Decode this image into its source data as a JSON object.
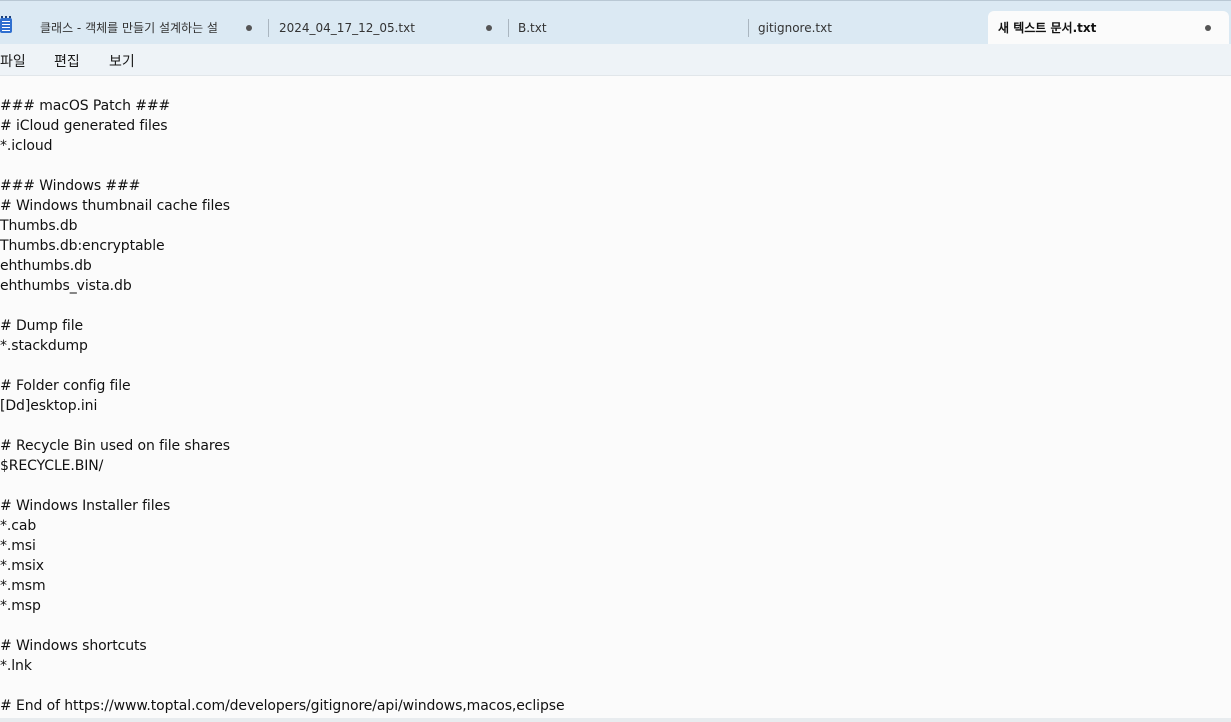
{
  "tabs": [
    {
      "label": "클래스 - 객체를 만들기 설계하는 설",
      "modified": true,
      "active": false
    },
    {
      "label": "2024_04_17_12_05.txt",
      "modified": true,
      "active": false
    },
    {
      "label": "B.txt",
      "modified": false,
      "active": false
    },
    {
      "label": "gitignore.txt",
      "modified": false,
      "active": false
    },
    {
      "label": "새 텍스트 문서.txt",
      "modified": true,
      "active": true
    }
  ],
  "menu": {
    "file": "파일",
    "edit": "편집",
    "view": "보기"
  },
  "editor_lines": [
    "### macOS Patch ###",
    "# iCloud generated files",
    "*.icloud",
    "",
    "### Windows ###",
    "# Windows thumbnail cache files",
    "Thumbs.db",
    "Thumbs.db:encryptable",
    "ehthumbs.db",
    "ehthumbs_vista.db",
    "",
    "# Dump file",
    "*.stackdump",
    "",
    "# Folder config file",
    "[Dd]esktop.ini",
    "",
    "# Recycle Bin used on file shares",
    "$RECYCLE.BIN/",
    "",
    "# Windows Installer files",
    "*.cab",
    "*.msi",
    "*.msix",
    "*.msm",
    "*.msp",
    "",
    "# Windows shortcuts",
    "*.lnk",
    "",
    "# End of https://www.toptal.com/developers/gitignore/api/windows,macos,eclipse"
  ]
}
